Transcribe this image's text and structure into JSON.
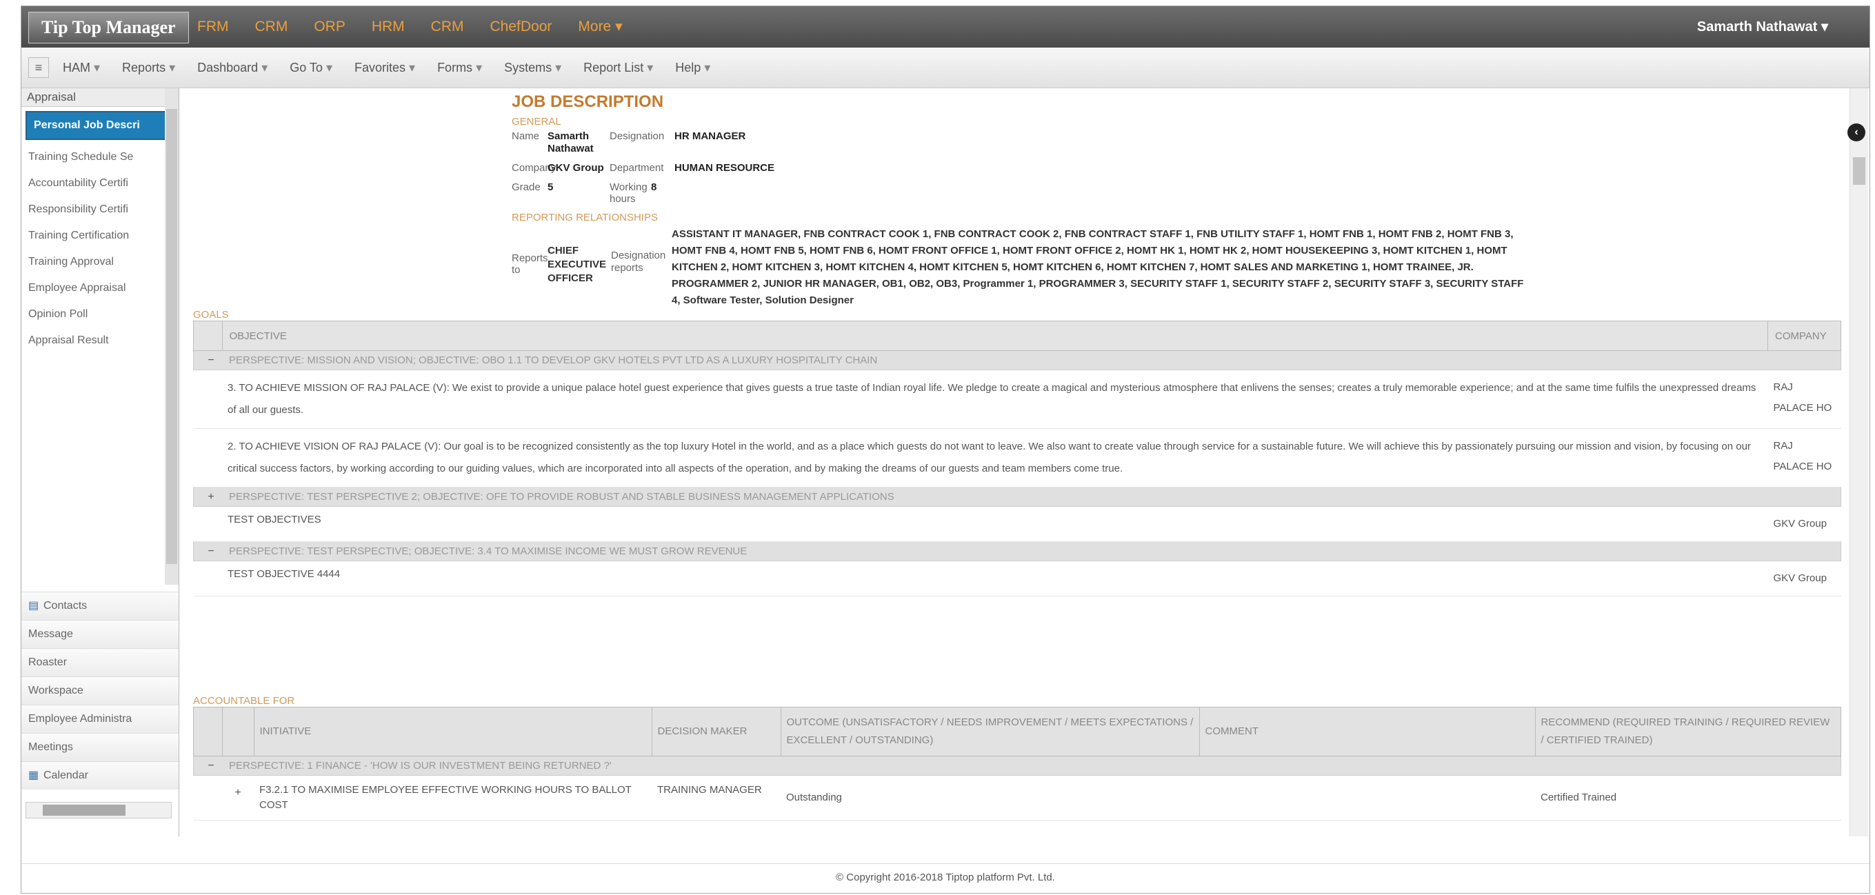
{
  "app": {
    "brand": "Tip Top Manager",
    "modules": [
      "FRM",
      "CRM",
      "ORP",
      "HRM",
      "CRM",
      "ChefDoor",
      "More"
    ],
    "user": "Samarth Nathawat"
  },
  "menubar": {
    "items": [
      "HAM",
      "Reports",
      "Dashboard",
      "Go To",
      "Favorites",
      "Forms",
      "Systems",
      "Report List",
      "Help"
    ]
  },
  "sidebar": {
    "header": "Appraisal",
    "items": [
      "Personal Job Descri",
      "Training Schedule Se",
      "Accountability Certifi",
      "Responsibility Certifi",
      "Training Certification",
      "Training Approval",
      "Employee Appraisal",
      "Opinion Poll",
      "Appraisal Result"
    ],
    "active_index": 0,
    "bottom": [
      {
        "label": "Contacts",
        "icon": "contacts-icon"
      },
      {
        "label": "Message",
        "icon": ""
      },
      {
        "label": "Roaster",
        "icon": ""
      },
      {
        "label": "Workspace",
        "icon": ""
      },
      {
        "label": "Employee Administra",
        "icon": ""
      },
      {
        "label": "Meetings",
        "icon": ""
      },
      {
        "label": "Calendar",
        "icon": "calendar-icon"
      }
    ]
  },
  "job": {
    "title": "JOB DESCRIPTION",
    "general": "GENERAL",
    "name_label": "Name",
    "name": "Samarth Nathawat",
    "designation_label": "Designation",
    "designation": "HR MANAGER",
    "company_label": "Company",
    "company": "GKV Group",
    "department_label": "Department",
    "department": "HUMAN RESOURCE",
    "grade_label": "Grade",
    "grade": "5",
    "hours_label": "Working hours",
    "hours": "8",
    "reporting": "REPORTING RELATIONSHIPS",
    "reports_to_label": "Reports to",
    "reports_to": "CHIEF EXECUTIVE OFFICER",
    "designation_reports_label": "Designation reports",
    "designation_reports": "ASSISTANT IT MANAGER, FNB CONTRACT COOK 1, FNB CONTRACT COOK 2, FNB CONTRACT STAFF 1, FNB UTILITY STAFF 1, HOMT FNB 1, HOMT FNB 2, HOMT FNB 3, HOMT FNB 4, HOMT FNB 5, HOMT FNB 6, HOMT FRONT OFFICE 1, HOMT FRONT OFFICE 2, HOMT HK 1, HOMT HK 2, HOMT HOUSEKEEPING 3, HOMT KITCHEN 1, HOMT KITCHEN 2, HOMT KITCHEN 3, HOMT KITCHEN 4, HOMT KITCHEN 5, HOMT KITCHEN 6, HOMT KITCHEN 7, HOMT SALES AND MARKETING 1, HOMT TRAINEE, JR. PROGRAMMER 2, JUNIOR HR MANAGER, OB1, OB2, OB3, Programmer 1, PROGRAMMER 3, SECURITY STAFF 1, SECURITY STAFF 2, SECURITY STAFF 3, SECURITY STAFF 4, Software Tester, Solution Designer"
  },
  "goals": {
    "label": "GOALS",
    "col_objective": "OBJECTIVE",
    "col_company": "COMPANY",
    "groups": [
      {
        "toggle": "−",
        "perspective": "PERSPECTIVE: MISSION AND VISION; OBJECTIVE: OBO 1.1 TO DEVELOP GKV HOTELS PVT LTD AS A LUXURY HOSPITALITY CHAIN",
        "rows": [
          {
            "objective": "3. TO ACHIEVE MISSION OF RAJ PALACE (V): We exist to provide a unique palace hotel guest experience that gives guests a true taste of Indian royal life. We pledge to create a magical and mysterious atmosphere that enlivens the senses; creates a truly memorable experience; and at the same time fulfils the unexpressed dreams of all our guests.",
            "company": "RAJ PALACE HO"
          },
          {
            "objective": "2. TO ACHIEVE VISION OF RAJ PALACE (V): Our goal is to be recognized consistently as the top luxury Hotel in the world, and as a place which guests do not want to leave. We also want to create value through service for a sustainable future. We will achieve this by passionately pursuing our mission and vision, by focusing on our critical success factors, by working according to our guiding values, which are incorporated into all aspects of the operation, and by making the dreams of our guests and team members come true.",
            "company": "RAJ PALACE HO"
          }
        ]
      },
      {
        "toggle": "+",
        "perspective": "PERSPECTIVE: TEST PERSPECTIVE 2; OBJECTIVE: OFE TO PROVIDE ROBUST AND STABLE BUSINESS MANAGEMENT APPLICATIONS",
        "rows": [
          {
            "objective": "TEST OBJECTIVES",
            "company": "GKV Group"
          }
        ]
      },
      {
        "toggle": "−",
        "perspective": "PERSPECTIVE: TEST PERSPECTIVE; OBJECTIVE: 3.4 TO MAXIMISE INCOME WE MUST GROW REVENUE",
        "rows": [
          {
            "objective": "TEST OBJECTIVE 4444",
            "company": "GKV Group"
          }
        ]
      }
    ]
  },
  "accountable": {
    "label": "ACCOUNTABLE FOR",
    "cols": [
      "INITIATIVE",
      "DECISION MAKER",
      "OUTCOME (UNSATISFACTORY / NEEDS IMPROVEMENT / MEETS EXPECTATIONS / EXCELLENT / OUTSTANDING)",
      "COMMENT",
      "RECOMMEND (REQUIRED TRAINING / REQUIRED REVIEW / CERTIFIED TRAINED)"
    ],
    "perspective": "PERSPECTIVE: 1 FINANCE - 'HOW IS OUR INVESTMENT BEING RETURNED ?'",
    "row": {
      "initiative": "F3.2.1 TO MAXIMISE EMPLOYEE EFFECTIVE WORKING HOURS TO BALLOT COST",
      "decision": "TRAINING MANAGER",
      "outcome": "Outstanding",
      "comment": "",
      "recommend": "Certified Trained"
    }
  },
  "footer": "© Copyright 2016-2018 Tiptop platform Pvt. Ltd."
}
